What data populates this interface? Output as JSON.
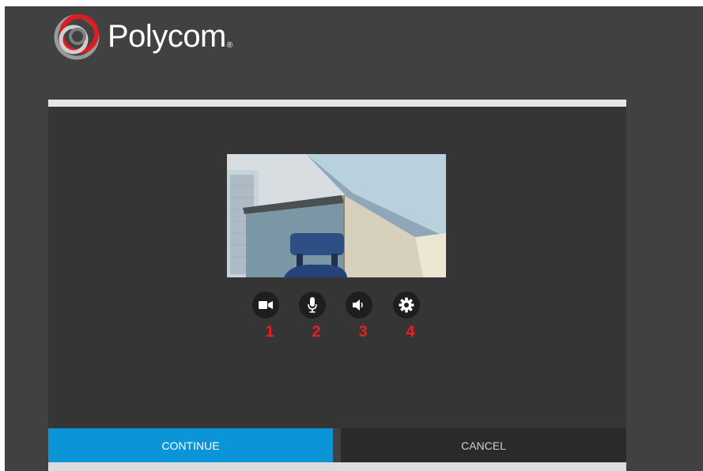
{
  "brand": {
    "name": "Polycom",
    "registered_mark": "®",
    "logo_icon": "polycom-logo-icon",
    "colors": {
      "logo_red": "#d81e23",
      "logo_gray": "#b9b9b9"
    }
  },
  "media_preview": {
    "content": "camera-preview-image"
  },
  "controls": [
    {
      "icon": "video-camera-icon",
      "number": "1"
    },
    {
      "icon": "microphone-icon",
      "number": "2"
    },
    {
      "icon": "speaker-icon",
      "number": "3"
    },
    {
      "icon": "gear-icon",
      "number": "4"
    }
  ],
  "actions": {
    "continue_label": "CONTINUE",
    "cancel_label": "CANCEL"
  },
  "colors": {
    "background": "#414141",
    "panel": "#353535",
    "accent_blue": "#0b94d8",
    "annotation_red": "#e4211b"
  }
}
